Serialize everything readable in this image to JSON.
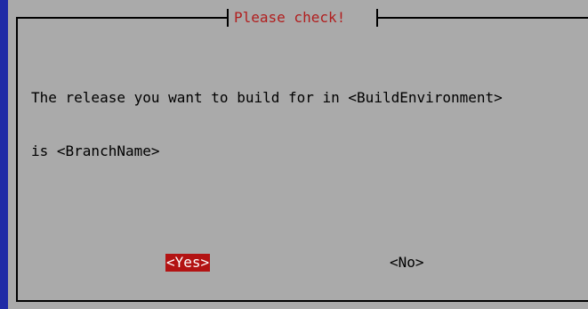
{
  "dialog": {
    "title": "Please check!",
    "message_line1": "The release you want to build for in <BuildEnvironment>",
    "message_line2": "is <BranchName>"
  },
  "buttons": {
    "yes_label": "<Yes>",
    "no_label": "<No>"
  },
  "colors": {
    "screen_background": "#1f2aa6",
    "dialog_background": "#aaaaaa",
    "title_text": "#b11e1e",
    "selected_button_background": "#b31313",
    "selected_button_text": "#ffffff"
  }
}
